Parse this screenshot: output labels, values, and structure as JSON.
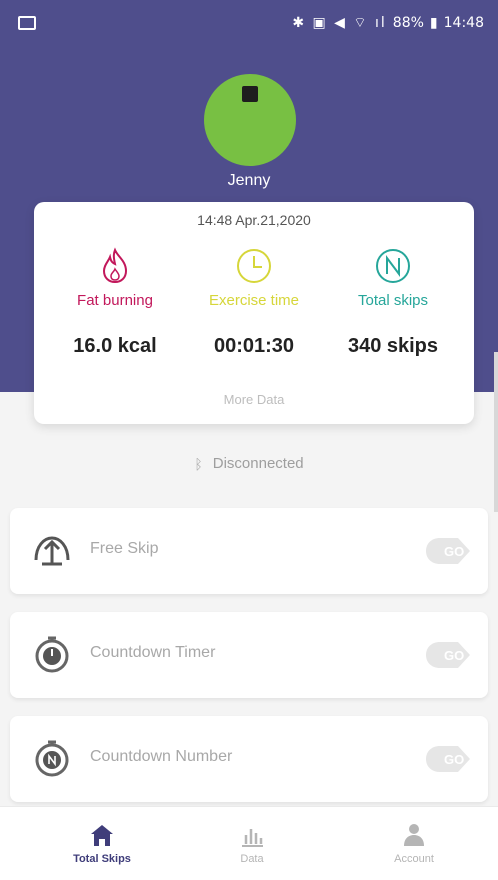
{
  "status_bar": {
    "icons": "✱ ▣ ◀ ⌔ ıl",
    "battery": "88%",
    "time": "14:48"
  },
  "user": {
    "name": "Jenny"
  },
  "stats_card": {
    "datetime": "14:48 Apr.21,2020",
    "more_data": "More Data",
    "fat_burning": {
      "label": "Fat burning",
      "value": "16.0 kcal",
      "color": "#c2185b"
    },
    "exercise_time": {
      "label": "Exercise time",
      "value": "00:01:30",
      "color": "#d6d63a"
    },
    "total_skips": {
      "label": "Total skips",
      "value": "340 skips",
      "color": "#26a69a"
    }
  },
  "connection": {
    "status": "Disconnected"
  },
  "modes": [
    {
      "label": "Free Skip",
      "icon": "skip-arrow-icon"
    },
    {
      "label": "Countdown Timer",
      "icon": "stopwatch-icon"
    },
    {
      "label": "Countdown Number",
      "icon": "counter-icon"
    }
  ],
  "tabs": [
    {
      "label": "Total Skips",
      "icon": "home-icon",
      "active": true
    },
    {
      "label": "Data",
      "icon": "bar-chart-icon",
      "active": false
    },
    {
      "label": "Account",
      "icon": "user-icon",
      "active": false
    }
  ],
  "colors": {
    "header_bg": "#4f4e8c",
    "avatar_bg": "#78c043",
    "tab_active": "#3f3d7a",
    "tab_inactive": "#b5b5b5"
  }
}
